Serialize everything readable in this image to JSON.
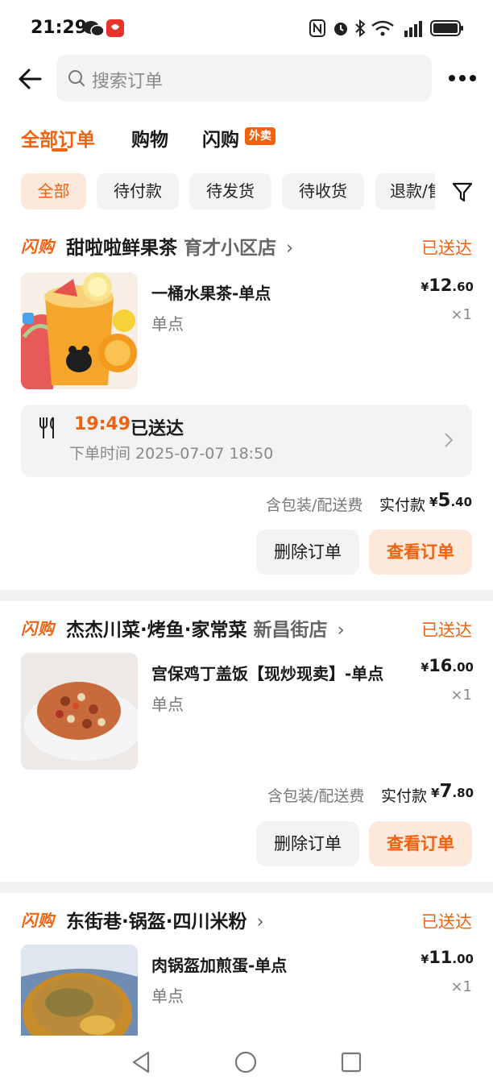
{
  "status_bar": {
    "time": "21:29"
  },
  "header": {
    "search_placeholder": "搜索订单"
  },
  "tabs": [
    {
      "label": "全部订单"
    },
    {
      "label": "购物"
    },
    {
      "label": "闪购"
    }
  ],
  "tab_badge": "外卖",
  "chips": [
    "全部",
    "待付款",
    "待发货",
    "待收货",
    "退款/售"
  ],
  "orders": [
    {
      "brand": "闪购",
      "shop": "甜啦啦鲜果茶",
      "branch": "育才小区店",
      "status": "已送达",
      "item_name": "一桶水果茶-单点",
      "item_spec": "单点",
      "price_yen": "¥",
      "price_int": "12",
      "price_dec": ".60",
      "qty": "×1",
      "delivery_time": "19:49",
      "delivery_status": "已送达",
      "order_time": "下单时间 2025-07-07 18:50",
      "fee_label": "含包装/配送费",
      "paid_label": "实付款",
      "paid_yen": "¥",
      "paid_int": "5",
      "paid_dec": ".40",
      "btn_delete": "删除订单",
      "btn_view": "查看订单"
    },
    {
      "brand": "闪购",
      "shop": "杰杰川菜·烤鱼·家常菜",
      "branch": "新昌街店",
      "status": "已送达",
      "item_name": "宫保鸡丁盖饭【现炒现卖】-单点",
      "item_spec": "单点",
      "price_yen": "¥",
      "price_int": "16",
      "price_dec": ".00",
      "qty": "×1",
      "fee_label": "含包装/配送费",
      "paid_label": "实付款",
      "paid_yen": "¥",
      "paid_int": "7",
      "paid_dec": ".80",
      "btn_delete": "删除订单",
      "btn_view": "查看订单"
    },
    {
      "brand": "闪购",
      "shop": "东街巷·锅盔·四川米粉",
      "branch": "",
      "status": "已送达",
      "item_name": "肉锅盔加煎蛋-单点",
      "item_spec": "单点",
      "price_yen": "¥",
      "price_int": "11",
      "price_dec": ".00",
      "qty": "×1"
    }
  ],
  "icons": {
    "back": "back-arrow-icon",
    "search": "search-icon",
    "more": "more-icon",
    "filter": "filter-icon",
    "fork_knife": "fork-knife-icon"
  },
  "colors": {
    "accent": "#f0620e",
    "accent_bg": "#fde8dc",
    "brand_blue": "#2f7cf6"
  }
}
